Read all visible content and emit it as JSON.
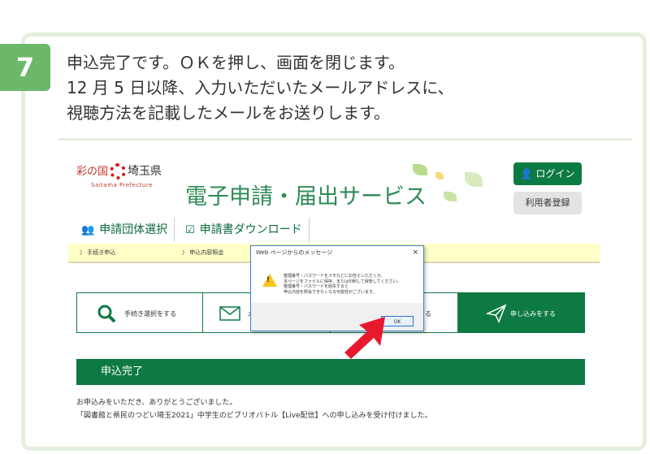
{
  "step": {
    "number": "7",
    "lines": [
      "申込完了です。ＯＫを押し、画面を閉じます。",
      "12 月 5 日以降、入力いただいたメールアドレスに、",
      "視聴方法を記載したメールをお送りします。"
    ]
  },
  "site": {
    "pref_name_a": "彩の国",
    "pref_name_b": "埼玉県",
    "pref_roman": "Saitama Prefecture",
    "service_title": "電子申請・届出サービス",
    "login_label": "ログイン",
    "register_label": "利用者登録",
    "nav": [
      {
        "label": "申請団体選択",
        "icon": "group-icon"
      },
      {
        "label": "申請書ダウンロード",
        "icon": "download-icon"
      }
    ],
    "subnav": [
      "〉 手続き申込",
      "〉 申込内容照会"
    ],
    "steps": [
      {
        "label": "手続き選択をする",
        "icon": "search-icon"
      },
      {
        "label": "メ",
        "icon": "mail-icon"
      },
      {
        "label": "る",
        "icon": ""
      },
      {
        "label": "申し込みをする",
        "icon": "send-icon"
      }
    ],
    "complete_label": "申込完了",
    "messages": [
      "お申込みをいただき、ありがとうございました。",
      "「図書館と県民のつどい埼玉2021」中学生のビブリオバトル【Live配信】への申し込みを受け付けました。"
    ]
  },
  "dialog": {
    "title": "Web ページからのメッセージ",
    "close": "×",
    "lines": [
      "整理番号・パスワードをメモなどにお控えいただくか、",
      "本ページをファイルに保存、または印刷して保管してください。",
      "整理番号・パスワードを紛失すると",
      "申込内容を照会できなくなる可能性がございます。"
    ],
    "ok_label": "OK"
  },
  "colors": {
    "badge": "#6bb86b",
    "brand_green": "#0d7a43",
    "frame": "#e4efdc",
    "arrow": "#e8182e"
  }
}
